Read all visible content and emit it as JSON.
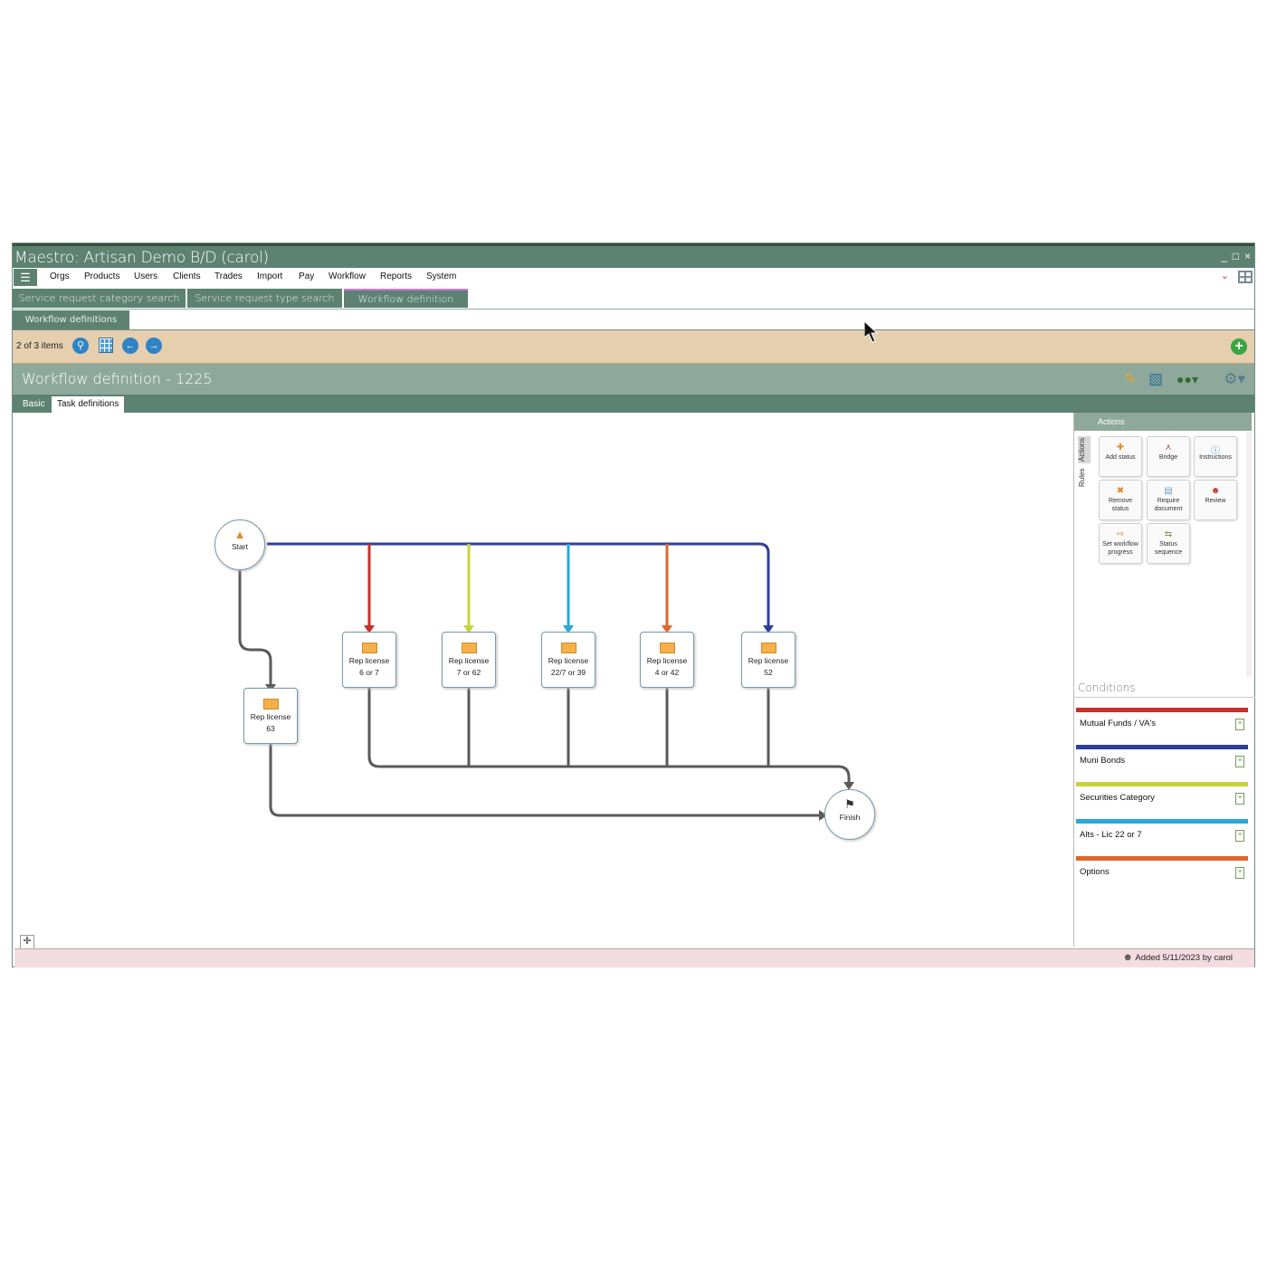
{
  "window": {
    "title": "Maestro: Artisan Demo B/D (carol)",
    "controls": [
      "_",
      "□",
      "×"
    ]
  },
  "menubar": {
    "hamburger": "☰",
    "items": [
      "Orgs",
      "Products",
      "Users",
      "Clients",
      "Trades",
      "Import",
      "Pay",
      "Workflow",
      "Reports",
      "System"
    ],
    "chevron": "⌄",
    "apps_icon": "apps-grid-icon"
  },
  "tabs": [
    "Service request category search",
    "Service request type search",
    "Workflow definition"
  ],
  "subtab": "Workflow definitions",
  "nav": {
    "count": "2 of 3 items",
    "icons": [
      "search-icon",
      "calendar-icon",
      "back-arrow-icon",
      "forward-arrow-icon"
    ]
  },
  "header": {
    "title": "Workflow definition - 1225",
    "icons": [
      "pencil-icon",
      "trash-icon",
      "binoculars-icon",
      "gear-icon"
    ]
  },
  "inner_tabs": [
    "Basic",
    "Task definitions"
  ],
  "actions_panel": {
    "heading": "Actions",
    "vertical_tabs": [
      "Actions",
      "Rules"
    ],
    "buttons": [
      {
        "label": "Add status",
        "icon": "add-status-icon"
      },
      {
        "label": "Bridge",
        "icon": "bridge-icon"
      },
      {
        "label": "Instructions",
        "icon": "info-icon"
      },
      {
        "label": "Remove status",
        "icon": "remove-status-icon"
      },
      {
        "label": "Require document",
        "icon": "document-icon"
      },
      {
        "label": "Review",
        "icon": "user-icon"
      },
      {
        "label": "Set workflow progress",
        "icon": "progress-icon"
      },
      {
        "label": "Status sequence",
        "icon": "sequence-icon"
      }
    ]
  },
  "conditions": {
    "heading": "Conditions",
    "items": [
      {
        "label": "Mutual Funds / VA's",
        "color": "#c8302a"
      },
      {
        "label": "Muni Bonds",
        "color": "#2d3f9a"
      },
      {
        "label": "Securities Category",
        "color": "#c8d33a"
      },
      {
        "label": "Alts - Lic 22 or 7",
        "color": "#2aa8d8"
      },
      {
        "label": "Options",
        "color": "#e0662a"
      }
    ]
  },
  "diagram": {
    "start_label": "Start",
    "finish_label": "Finish",
    "nodes": [
      {
        "line1": "Rep license",
        "line2": "6 or 7"
      },
      {
        "line1": "Rep license",
        "line2": "7 or 62"
      },
      {
        "line1": "Rep license",
        "line2": "22/7 or 39"
      },
      {
        "line1": "Rep license",
        "line2": "4 or 42"
      },
      {
        "line1": "Rep license",
        "line2": "52"
      },
      {
        "line1": "Rep license",
        "line2": "63"
      }
    ],
    "colors": {
      "red": "#c8302a",
      "yellow": "#c8d33a",
      "cyan": "#2aa8d8",
      "orange": "#e0662a",
      "blue": "#2d3f9a",
      "gray": "#5a5a5a"
    }
  },
  "footer": {
    "text": "Added 5/11/2023 by carol",
    "icon": "user-icon"
  },
  "colors": {
    "titlebar": "#5d8272",
    "navbar": "#e6cfae",
    "header": "#8ea99b",
    "footer": "#f4dde2",
    "accent_tab": "#c97bd6"
  }
}
